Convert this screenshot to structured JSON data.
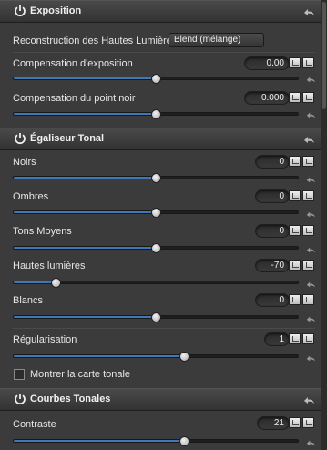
{
  "sections": {
    "exposition": {
      "title": "Exposition"
    },
    "egaliseur": {
      "title": "Égaliseur Tonal"
    },
    "courbes": {
      "title": "Courbes Tonales"
    }
  },
  "highlight_reconstruction": {
    "label": "Reconstruction des Hautes Lumières:",
    "value": "Blend (mélange)"
  },
  "sliders": {
    "compensation_exposition": {
      "label": "Compensation d'exposition",
      "value": "0.00",
      "level": 0.5
    },
    "compensation_point_noir": {
      "label": "Compensation du point noir",
      "value": "0.000",
      "level": 0.5
    },
    "noirs": {
      "label": "Noirs",
      "value": "0",
      "level": 0.5
    },
    "ombres": {
      "label": "Ombres",
      "value": "0",
      "level": 0.5
    },
    "tons_moyens": {
      "label": "Tons Moyens",
      "value": "0",
      "level": 0.5
    },
    "hautes_lumieres": {
      "label": "Hautes lumières",
      "value": "-70",
      "level": 0.15
    },
    "blancs": {
      "label": "Blancs",
      "value": "0",
      "level": 0.5
    },
    "regularisation": {
      "label": "Régularisation",
      "value": "1",
      "level": 0.6
    },
    "contraste": {
      "label": "Contraste",
      "value": "21",
      "level": 0.6
    }
  },
  "show_tone_map": {
    "label": "Montrer la carte tonale",
    "checked": false
  },
  "colors": {
    "accent": "#3f77b8"
  }
}
